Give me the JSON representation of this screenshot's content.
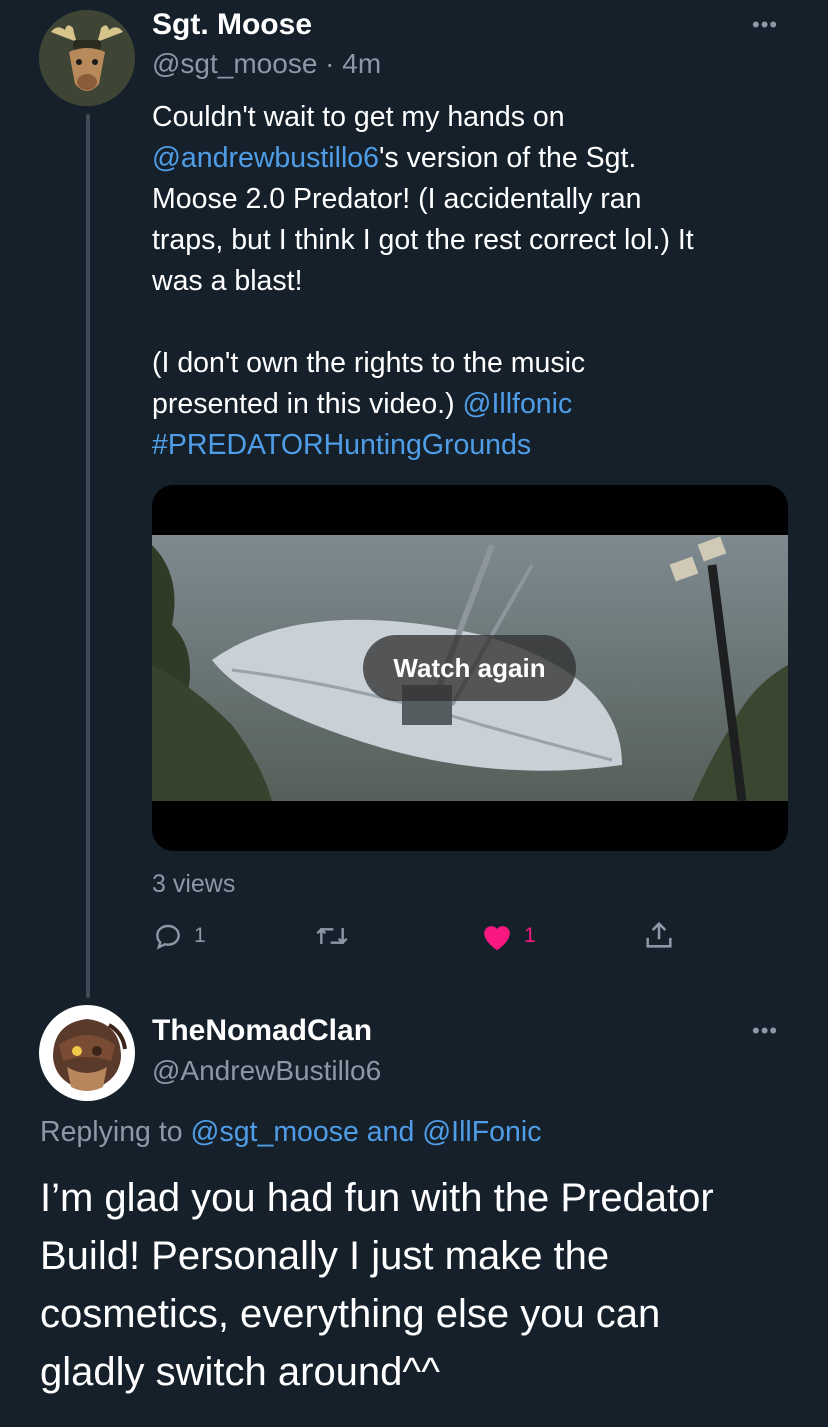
{
  "tweet": {
    "author_name": "Sgt. Moose",
    "handle": "@sgt_moose",
    "dot": "·",
    "time": "4m",
    "more_label": "•••",
    "lines": [
      [
        {
          "t": "Couldn't wait to get my hands on",
          "link": false
        }
      ],
      [
        {
          "t": "@andrewbustillo6",
          "link": true
        },
        {
          "t": "'s version of the Sgt.",
          "link": false
        }
      ],
      [
        {
          "t": "Moose 2.0 Predator! (I accidentally ran",
          "link": false
        }
      ],
      [
        {
          "t": "traps, but I think I got the rest correct lol.) It",
          "link": false
        }
      ],
      [
        {
          "t": "was a blast!",
          "link": false
        }
      ],
      [],
      [
        {
          "t": "(I don't own the rights to the music",
          "link": false
        }
      ],
      [
        {
          "t": "presented in this video.) ",
          "link": false
        },
        {
          "t": "@Illfonic",
          "link": true
        }
      ],
      [
        {
          "t": "#PREDATORHuntingGrounds",
          "link": true
        }
      ]
    ],
    "video": {
      "watch_again_label": "Watch again"
    },
    "views_text": "3 views",
    "reply_count": "1",
    "retweet_count": "",
    "like_count": "1",
    "like_color": "#f91880"
  },
  "reply": {
    "author_name": "TheNomadClan",
    "handle": "@AndrewBustillo6",
    "more_label": "•••",
    "replying_prefix": "Replying to ",
    "replying_user1": "@sgt_moose",
    "replying_and": " and ",
    "replying_user2": "@IllFonic",
    "body_lines": [
      "I’m glad you had fun with the Predator",
      "Build! Personally I just make the",
      "cosmetics, everything else you can",
      "gladly switch around^^"
    ]
  },
  "colors": {
    "background": "#15202b",
    "link": "#4f9de6",
    "secondary_text": "#8b98a5",
    "like": "#f91880"
  },
  "icons": [
    "reply-icon",
    "retweet-icon",
    "heart-icon",
    "share-icon",
    "more-icon"
  ]
}
